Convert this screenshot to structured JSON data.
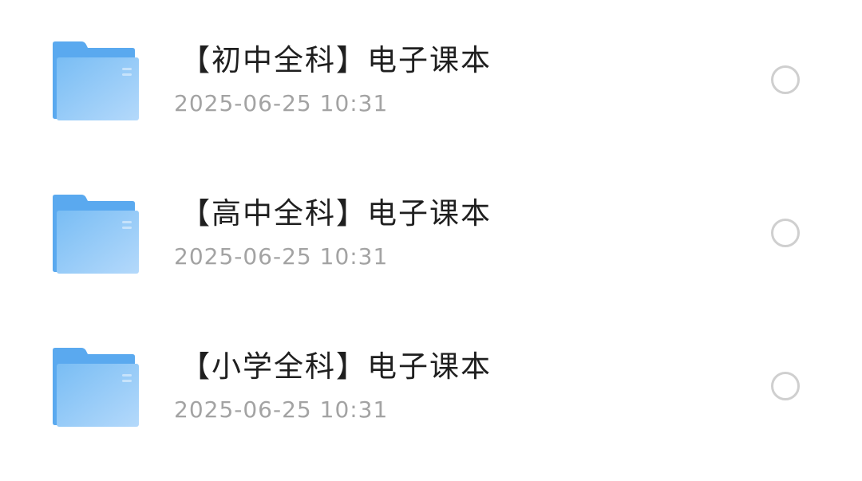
{
  "files": [
    {
      "name": "【初中全科】电子课本",
      "date": "2025-06-25 10:31",
      "icon": "folder-icon",
      "selected": false
    },
    {
      "name": "【高中全科】电子课本",
      "date": "2025-06-25 10:31",
      "icon": "folder-icon",
      "selected": false
    },
    {
      "name": "【小学全科】电子课本",
      "date": "2025-06-25 10:31",
      "icon": "folder-icon",
      "selected": false
    }
  ],
  "colors": {
    "folder_back": "#5aa9ef",
    "folder_front_light": "#b4d9fb",
    "folder_front_dark": "#79bdf4",
    "name_text": "#1f1f1f",
    "date_text": "#a3a3a3",
    "radio_border": "#cfcfcf"
  }
}
